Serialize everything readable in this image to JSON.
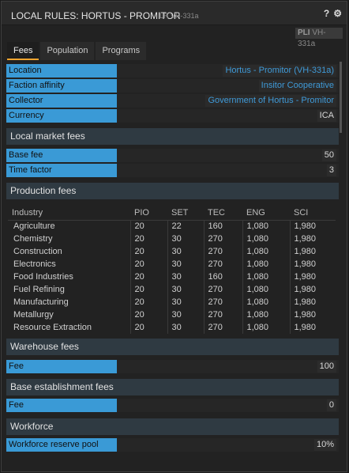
{
  "window": {
    "title": "LOCAL RULES: HORTUS - PROMITOR",
    "subtitle": "LR VH-331a",
    "help_symbol": "?",
    "settings_symbol": "⚙"
  },
  "pli": {
    "key": "PLI",
    "value": "VH-331a"
  },
  "tabs": [
    {
      "label": "Fees",
      "active": true
    },
    {
      "label": "Population",
      "active": false
    },
    {
      "label": "Programs",
      "active": false
    }
  ],
  "info": {
    "location": {
      "label": "Location",
      "value": "Hortus - Promitor (VH-331a)"
    },
    "faction": {
      "label": "Faction affinity",
      "value": "Insitor Cooperative"
    },
    "collector": {
      "label": "Collector",
      "value": "Government of Hortus - Promitor"
    },
    "currency": {
      "label": "Currency",
      "value": "ICA"
    }
  },
  "local_market": {
    "header": "Local market fees",
    "base_fee": {
      "label": "Base fee",
      "value": "50"
    },
    "time_factor": {
      "label": "Time factor",
      "value": "3"
    }
  },
  "production": {
    "header": "Production fees",
    "columns": [
      "Industry",
      "PIO",
      "SET",
      "TEC",
      "ENG",
      "SCI"
    ],
    "rows": [
      [
        "Agriculture",
        "20",
        "22",
        "160",
        "1,080",
        "1,980"
      ],
      [
        "Chemistry",
        "20",
        "30",
        "270",
        "1,080",
        "1,980"
      ],
      [
        "Construction",
        "20",
        "30",
        "270",
        "1,080",
        "1,980"
      ],
      [
        "Electronics",
        "20",
        "30",
        "270",
        "1,080",
        "1,980"
      ],
      [
        "Food Industries",
        "20",
        "30",
        "160",
        "1,080",
        "1,980"
      ],
      [
        "Fuel Refining",
        "20",
        "30",
        "270",
        "1,080",
        "1,980"
      ],
      [
        "Manufacturing",
        "20",
        "30",
        "270",
        "1,080",
        "1,980"
      ],
      [
        "Metallurgy",
        "20",
        "30",
        "270",
        "1,080",
        "1,980"
      ],
      [
        "Resource Extraction",
        "20",
        "30",
        "270",
        "1,080",
        "1,980"
      ]
    ]
  },
  "warehouse": {
    "header": "Warehouse fees",
    "fee": {
      "label": "Fee",
      "value": "100"
    }
  },
  "base_establishment": {
    "header": "Base establishment fees",
    "fee": {
      "label": "Fee",
      "value": "0"
    }
  },
  "workforce": {
    "header": "Workforce",
    "reserve": {
      "label": "Workforce reserve pool",
      "value": "10%"
    }
  },
  "colors": {
    "accent": "#f0a530",
    "label_bg": "#3a9ad6",
    "link": "#3f9ad8",
    "section_bg": "#2f3a42"
  }
}
